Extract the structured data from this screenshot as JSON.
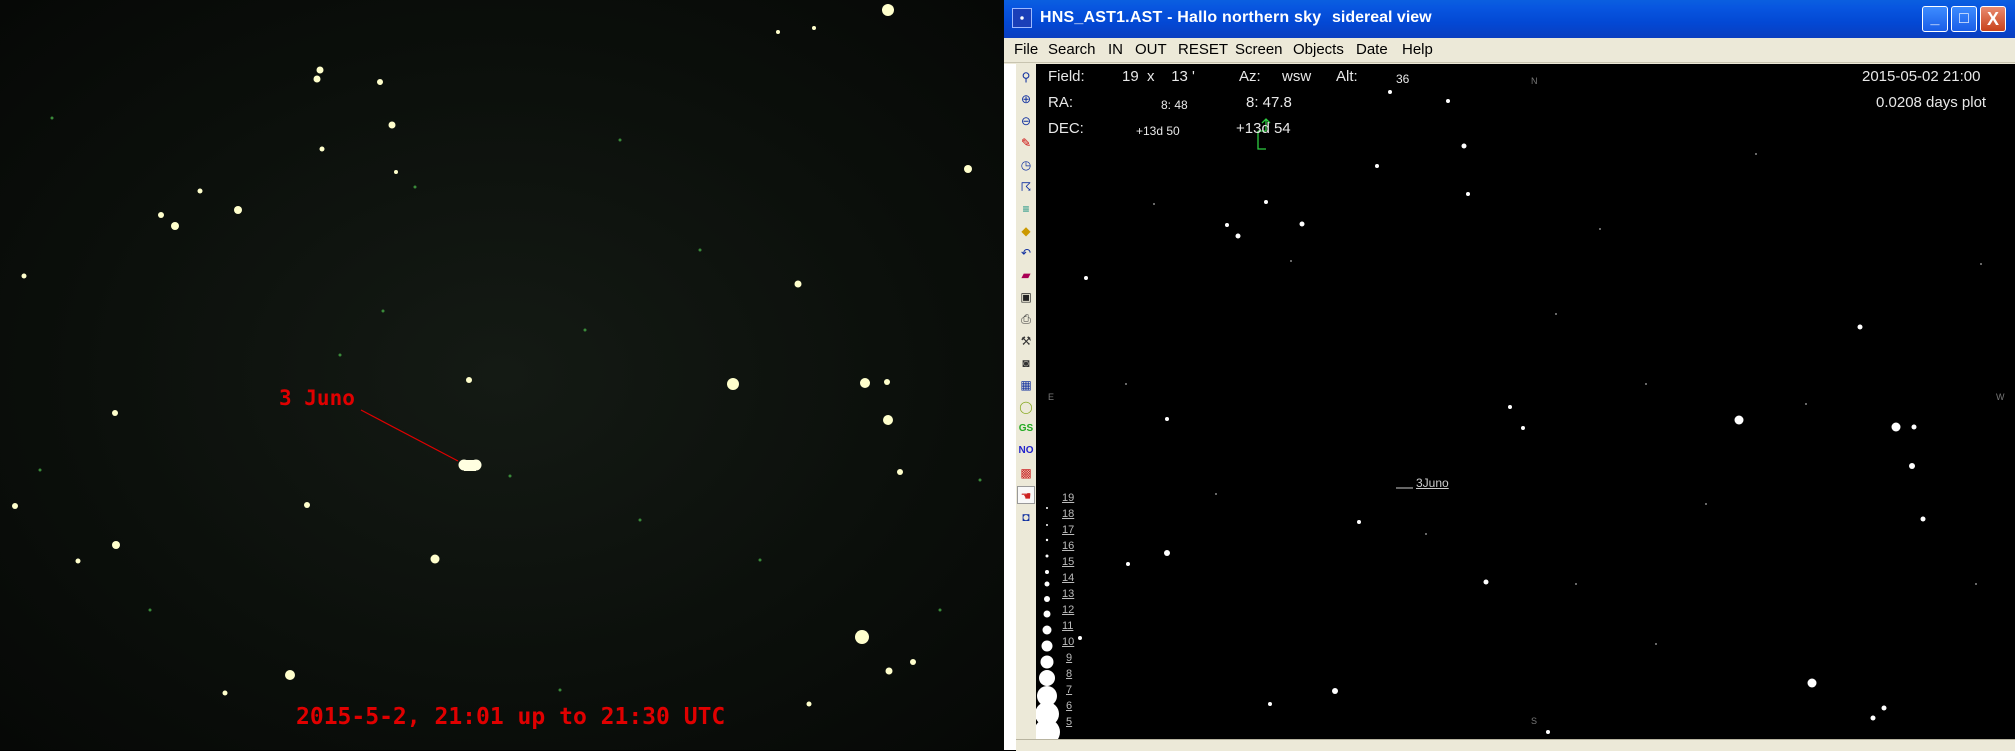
{
  "photo": {
    "object_label": "3 Juno",
    "caption": "2015-5-2, 21:01 up to 21:30 UTC"
  },
  "window": {
    "title": "HNS_AST1.AST - Hallo northern sky",
    "view_mode": "sidereal view",
    "controls": {
      "minimize": "_",
      "maximize": "□",
      "close": "X"
    }
  },
  "menu": [
    "File",
    "Search",
    "IN",
    "OUT",
    "RESET",
    "Screen",
    "Objects",
    "Date",
    "Help"
  ],
  "toolbar_icons": [
    "binoculars-icon",
    "zoom-in-icon",
    "zoom-out-icon",
    "pencil-icon",
    "clock-icon",
    "runner-icon",
    "stack-icon",
    "paint-icon",
    "undo-icon",
    "book-icon",
    "save-icon",
    "print-icon",
    "wrench-icon",
    "camera-icon",
    "calendar-icon",
    "ring-icon",
    "gs-icon",
    "no-icon",
    "grid-icon",
    "hand-icon",
    "photo-icon"
  ],
  "toolbar_text": {
    "gs": "GS",
    "no": "NO"
  },
  "sky": {
    "field_label": "Field:",
    "field_value": "19  x    13 '",
    "az_label": "Az:",
    "az_value": "wsw",
    "alt_label": "Alt:",
    "alt_value": "36",
    "ra_label": "RA:",
    "ra_small": "8: 48",
    "ra_value": "8: 47.8",
    "dec_label": "DEC:",
    "dec_small": "+13d 50",
    "dec_value": "+13d 54",
    "datetime": "2015-05-02  21:00",
    "plot_interval": "0.0208 days plot",
    "object_label": "3Juno",
    "directions": {
      "north": "N",
      "south": "S",
      "east": "E",
      "west": "W"
    },
    "magnitudes": [
      "19",
      "18",
      "17",
      "16",
      "15",
      "14",
      "13",
      "12",
      "11",
      "10",
      "9",
      "8",
      "7",
      "6",
      "5"
    ]
  },
  "colors": {
    "photo_label": "#e00000",
    "titlebar": "#0348d4",
    "sky_background": "#000000"
  }
}
